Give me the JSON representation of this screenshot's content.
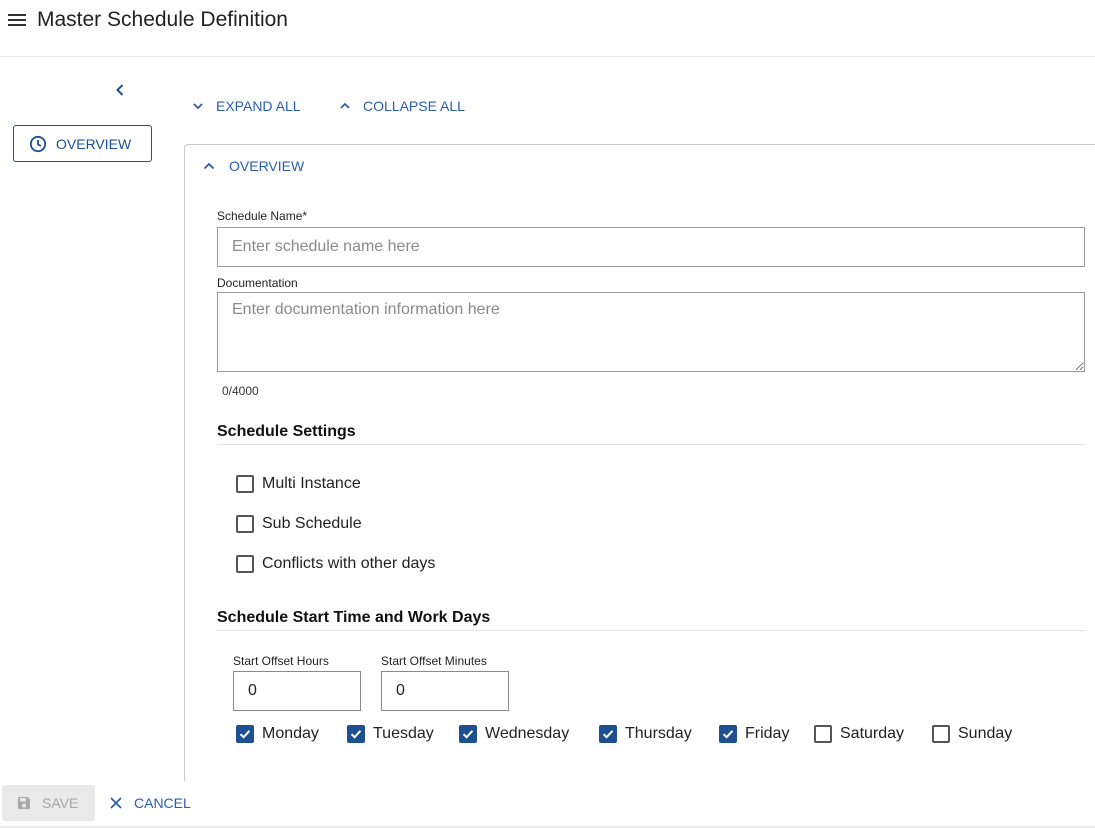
{
  "header": {
    "title": "Master Schedule Definition"
  },
  "sidebar": {
    "overview_label": "OVERVIEW"
  },
  "toolbar": {
    "expand_all": "EXPAND ALL",
    "collapse_all": "COLLAPSE ALL"
  },
  "panel": {
    "title": "OVERVIEW",
    "schedule_name": {
      "label": "Schedule Name*",
      "placeholder": "Enter schedule name here",
      "value": ""
    },
    "documentation": {
      "label": "Documentation",
      "placeholder": "Enter documentation information here",
      "value": "",
      "counter": "0/4000"
    },
    "settings": {
      "title": "Schedule Settings",
      "options": [
        {
          "label": "Multi Instance",
          "checked": false
        },
        {
          "label": "Sub Schedule",
          "checked": false
        },
        {
          "label": "Conflicts with other days",
          "checked": false
        }
      ]
    },
    "start_time": {
      "title": "Schedule Start Time and Work Days",
      "offset_hours": {
        "label": "Start Offset Hours",
        "value": "0"
      },
      "offset_minutes": {
        "label": "Start Offset Minutes",
        "value": "0"
      },
      "days": [
        {
          "label": "Monday",
          "checked": true
        },
        {
          "label": "Tuesday",
          "checked": true
        },
        {
          "label": "Wednesday",
          "checked": true
        },
        {
          "label": "Thursday",
          "checked": true
        },
        {
          "label": "Friday",
          "checked": true
        },
        {
          "label": "Saturday",
          "checked": false
        },
        {
          "label": "Sunday",
          "checked": false
        }
      ]
    }
  },
  "footer": {
    "save_label": "SAVE",
    "cancel_label": "CANCEL"
  },
  "colors": {
    "accent": "#2a5db0",
    "check_fill": "#1d4f91",
    "disabled": "#a8a8a8"
  }
}
